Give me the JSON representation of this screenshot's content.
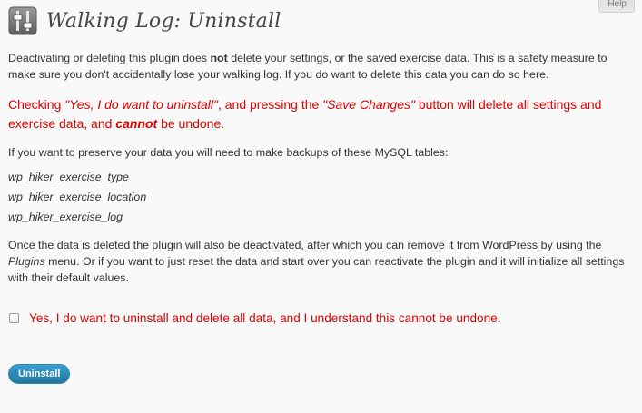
{
  "header": {
    "help_label": "Help",
    "title": "Walking Log: Uninstall",
    "icon": "plugin-sliders-icon"
  },
  "intro": {
    "part1": "Deactivating or deleting this plugin does ",
    "bold": "not",
    "part2": " delete your settings, or the saved exercise data. This is a safety measure to make sure you don't accidentally lose your walking log. If you do want to delete this data you can do so here."
  },
  "warning": {
    "part1": "Checking ",
    "checkbox_quote": "\"Yes, I do want to uninstall\"",
    "part2": ", and pressing the ",
    "button_quote": "\"Save Changes\"",
    "part3": " button will delete all settings and exercise data, and ",
    "emphasis": "cannot",
    "part4": " be undone."
  },
  "backup_note": "If you want to preserve your data you will need to make backups of these MySQL tables:",
  "tables": [
    "wp_hiker_exercise_type",
    "wp_hiker_exercise_location",
    "wp_hiker_exercise_log"
  ],
  "after_note": {
    "part1": "Once the data is deleted the plugin will also be deactivated, after which you can remove it from WordPress by using the ",
    "plugins_link": "Plugins",
    "part2": " menu. Or if you want to just reset the data and start over you can reactivate the plugin and it will initialize all settings with their default values."
  },
  "confirm": {
    "label": "Yes, I do want to uninstall and delete all data, and I understand this cannot be undone.",
    "checked": false
  },
  "actions": {
    "uninstall_label": "Uninstall"
  },
  "colors": {
    "warning": "#dd0000",
    "button": "#21759b",
    "background": "#f9f9f9"
  }
}
